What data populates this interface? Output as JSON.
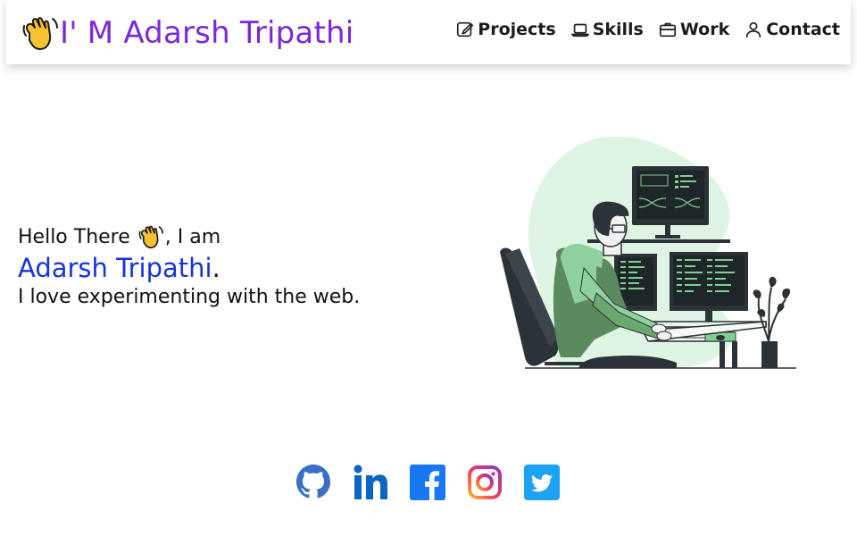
{
  "header": {
    "brand": "I' M Adarsh Tripathi",
    "nav": [
      {
        "label": "Projects",
        "icon": "edit-icon"
      },
      {
        "label": "Skills",
        "icon": "laptop-icon"
      },
      {
        "label": "Work",
        "icon": "briefcase-icon"
      },
      {
        "label": "Contact",
        "icon": "user-icon"
      }
    ]
  },
  "hero": {
    "greeting_pre": "Hello There ",
    "greeting_post": ", I am",
    "name": "Adarsh Tripathi",
    "name_suffix": ".",
    "tagline": "I love experimenting with the web."
  },
  "socials": [
    {
      "icon": "github-icon",
      "color": "#3b6fc4"
    },
    {
      "icon": "linkedin-icon",
      "color": "#0a66c2"
    },
    {
      "icon": "facebook-icon",
      "color": "#1877f2"
    },
    {
      "icon": "instagram-icon",
      "color": "#e1306c"
    },
    {
      "icon": "twitter-icon",
      "color": "#1da1f2"
    }
  ],
  "colors": {
    "brand": "#7b28d6",
    "name": "#1733d9",
    "illustration_accent": "#8fd19e"
  }
}
